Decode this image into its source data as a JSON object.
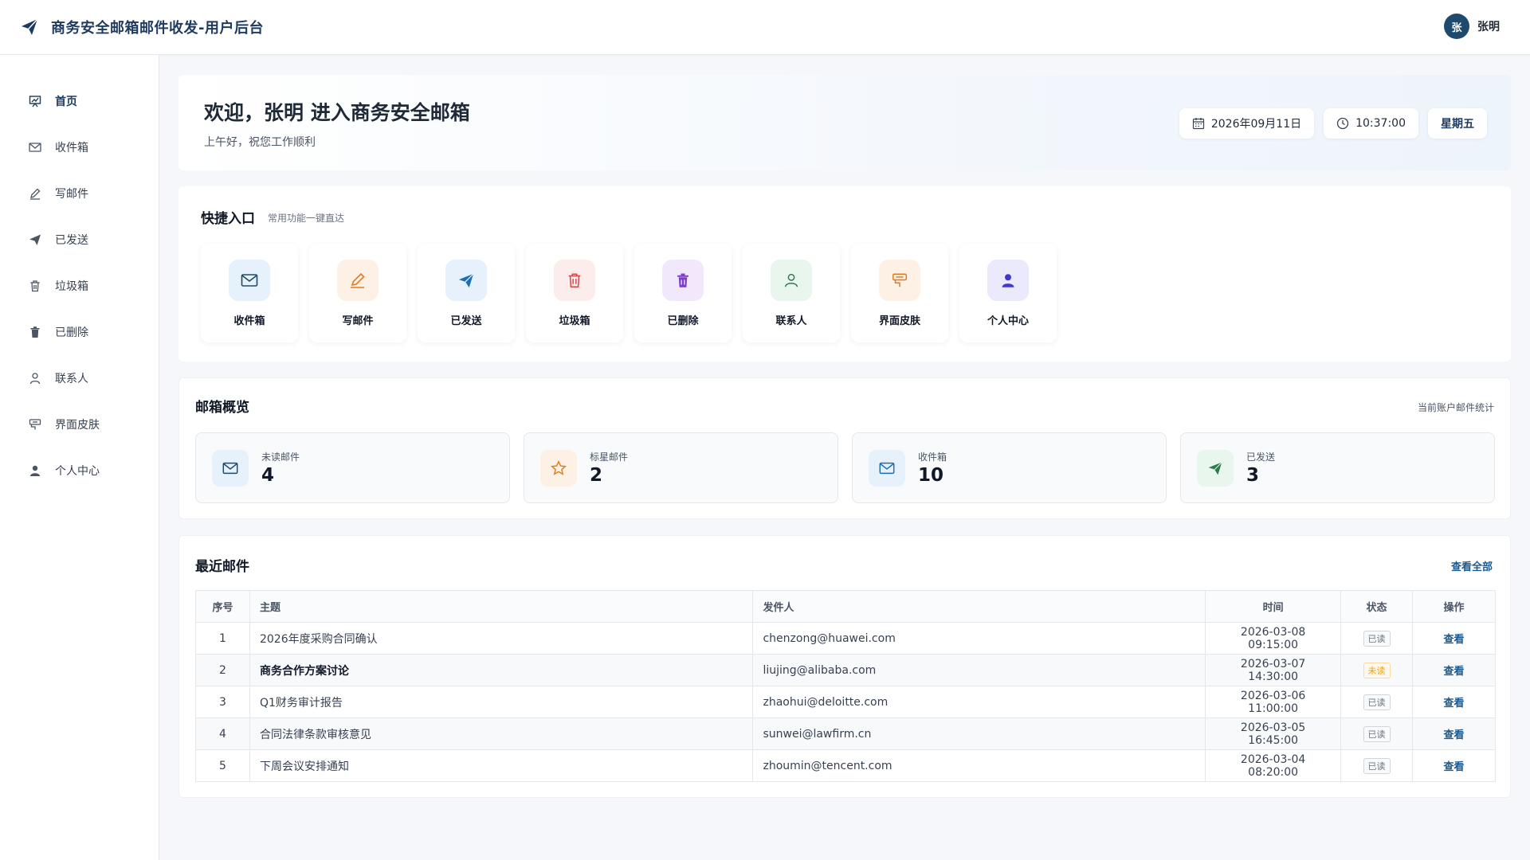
{
  "header": {
    "title": "商务安全邮箱邮件收发-用户后台",
    "avatar_char": "张",
    "user_name": "张明"
  },
  "sidebar": {
    "items": [
      {
        "label": "首页",
        "icon": "chart-board-icon",
        "active": true
      },
      {
        "label": "收件箱",
        "icon": "envelope-icon"
      },
      {
        "label": "写邮件",
        "icon": "pen-icon"
      },
      {
        "label": "已发送",
        "icon": "paper-plane-icon"
      },
      {
        "label": "垃圾箱",
        "icon": "trash-icon"
      },
      {
        "label": "已删除",
        "icon": "trash-filled-icon"
      },
      {
        "label": "联系人",
        "icon": "user-icon"
      },
      {
        "label": "界面皮肤",
        "icon": "paint-bucket-icon"
      },
      {
        "label": "个人中心",
        "icon": "person-filled-icon"
      }
    ]
  },
  "welcome": {
    "heading": "欢迎，张明 进入商务安全邮箱",
    "subtitle": "上午好，祝您工作顺利",
    "date": "2026年09月11日",
    "time": "10:37:00",
    "weekday": "星期五"
  },
  "quick": {
    "title": "快捷入口",
    "subtitle": "常用功能一键直达",
    "items": [
      {
        "label": "收件箱",
        "icon": "envelope-icon",
        "bg": "#e6f1fb",
        "color": "#1e4a6e"
      },
      {
        "label": "写邮件",
        "icon": "pen-icon",
        "bg": "#fdf0e4",
        "color": "#e07b1f"
      },
      {
        "label": "已发送",
        "icon": "paper-plane-icon",
        "bg": "#e6f1fb",
        "color": "#1e6fb0"
      },
      {
        "label": "垃圾箱",
        "icon": "trash-icon",
        "bg": "#fdecec",
        "color": "#d64545"
      },
      {
        "label": "已删除",
        "icon": "trash-filled-icon",
        "bg": "#f1e8fb",
        "color": "#7b3fc7"
      },
      {
        "label": "联系人",
        "icon": "user-icon",
        "bg": "#e8f6ee",
        "color": "#2f7a4c"
      },
      {
        "label": "界面皮肤",
        "icon": "paint-bucket-icon",
        "bg": "#fdf0e4",
        "color": "#e07b1f"
      },
      {
        "label": "个人中心",
        "icon": "person-filled-icon",
        "bg": "#eaeafc",
        "color": "#4338ca"
      }
    ]
  },
  "overview": {
    "title": "邮箱概览",
    "note": "当前账户邮件统计",
    "stats": [
      {
        "label": "未读邮件",
        "value": "4",
        "icon": "envelope-icon",
        "bg": "#e6f1fb",
        "color": "#1e4a6e"
      },
      {
        "label": "标星邮件",
        "value": "2",
        "icon": "star-icon",
        "bg": "#fdf0e4",
        "color": "#e07b1f"
      },
      {
        "label": "收件箱",
        "value": "10",
        "icon": "envelope-icon",
        "bg": "#e6f1fb",
        "color": "#1e6fb0"
      },
      {
        "label": "已发送",
        "value": "3",
        "icon": "paper-plane-icon",
        "bg": "#e8f6ee",
        "color": "#2f7a4c"
      }
    ]
  },
  "recent": {
    "title": "最近邮件",
    "view_all": "查看全部",
    "columns": [
      "序号",
      "主题",
      "发件人",
      "时间",
      "状态",
      "操作"
    ],
    "rows": [
      {
        "idx": "1",
        "subject": "2026年度采购合同确认",
        "from": "chenzong@huawei.com",
        "time": "2026-03-08 09:15:00",
        "status": "已读",
        "unread": false,
        "action": "查看"
      },
      {
        "idx": "2",
        "subject": "商务合作方案讨论",
        "from": "liujing@alibaba.com",
        "time": "2026-03-07 14:30:00",
        "status": "未读",
        "unread": true,
        "action": "查看"
      },
      {
        "idx": "3",
        "subject": "Q1财务审计报告",
        "from": "zhaohui@deloitte.com",
        "time": "2026-03-06 11:00:00",
        "status": "已读",
        "unread": false,
        "action": "查看"
      },
      {
        "idx": "4",
        "subject": "合同法律条款审核意见",
        "from": "sunwei@lawfirm.cn",
        "time": "2026-03-05 16:45:00",
        "status": "已读",
        "unread": false,
        "action": "查看"
      },
      {
        "idx": "5",
        "subject": "下周会议安排通知",
        "from": "zhoumin@tencent.com",
        "time": "2026-03-04 08:20:00",
        "status": "已读",
        "unread": false,
        "action": "查看"
      }
    ]
  }
}
